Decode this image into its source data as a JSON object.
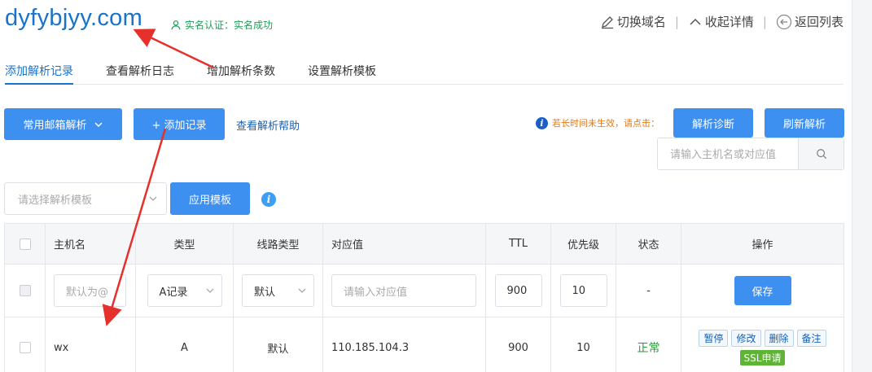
{
  "header": {
    "domain": "dyfybjyy.com",
    "verify_text": "实名认证：实名成功",
    "actions": {
      "switch_domain": "切换域名",
      "collapse": "收起详情",
      "back": "返回列表"
    }
  },
  "tabs": [
    {
      "label": "添加解析记录",
      "active": true
    },
    {
      "label": "查看解析日志"
    },
    {
      "label": "增加解析条数"
    },
    {
      "label": "设置解析模板"
    }
  ],
  "toolbar": {
    "mail_button": "常用邮箱解析",
    "add_button": "+ 添加记录",
    "help_link": "查看解析帮助",
    "tip": "若长时间未生效，请点击：",
    "diagnose_button": "解析诊断",
    "refresh_button": "刷新解析",
    "search_placeholder": "请输入主机名或对应值"
  },
  "template": {
    "select_placeholder": "请选择解析模板",
    "apply_button": "应用模板"
  },
  "table": {
    "headers": [
      "主机名",
      "类型",
      "线路类型",
      "对应值",
      "TTL",
      "优先级",
      "状态",
      "操作"
    ],
    "edit_row": {
      "host_placeholder": "默认为@",
      "type": "A记录",
      "line": "默认",
      "value_placeholder": "请输入对应值",
      "ttl": "900",
      "priority": "10",
      "status": "-",
      "save_button": "保存"
    },
    "rows": [
      {
        "host": "wx",
        "type": "A",
        "line": "默认",
        "value": "110.185.104.3",
        "ttl": "900",
        "priority": "10",
        "status": "正常",
        "ops": [
          "暂停",
          "修改",
          "删除",
          "备注"
        ],
        "ssl": "SSL申请"
      }
    ]
  },
  "colors": {
    "primary": "#3d8ff0",
    "link": "#1a73c8",
    "success": "#2e9a3c",
    "warning": "#e07a1a",
    "annotation": "#e5302b"
  }
}
